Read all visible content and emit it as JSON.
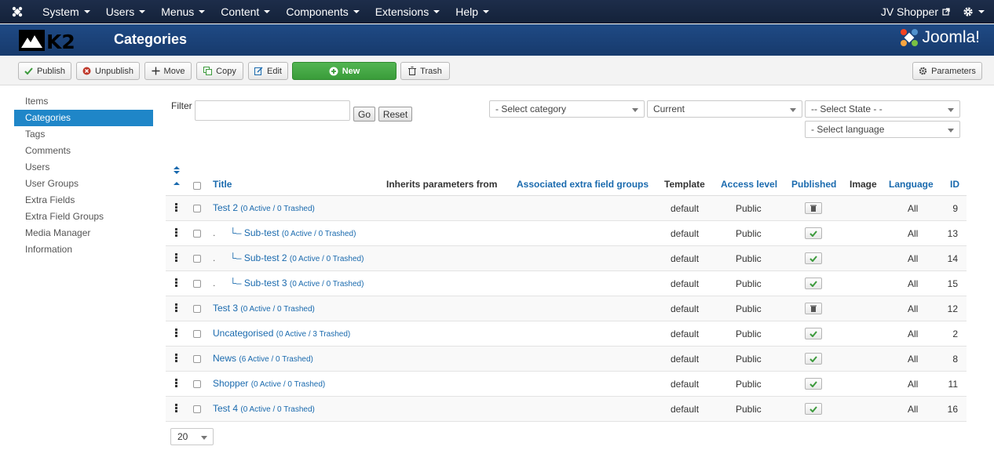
{
  "topbar": {
    "menu": [
      "System",
      "Users",
      "Menus",
      "Content",
      "Components",
      "Extensions",
      "Help"
    ],
    "user": "JV Shopper"
  },
  "header": {
    "title": "Categories",
    "brand": "Joomla!",
    "k2": "K2"
  },
  "toolbar": {
    "publish": "Publish",
    "unpublish": "Unpublish",
    "move": "Move",
    "copy": "Copy",
    "edit": "Edit",
    "new": "New",
    "trash": "Trash",
    "parameters": "Parameters"
  },
  "sidebar": {
    "items": [
      "Items",
      "Categories",
      "Tags",
      "Comments",
      "Users",
      "User Groups",
      "Extra Fields",
      "Extra Field Groups",
      "Media Manager",
      "Information"
    ]
  },
  "filters": {
    "label": "Filter",
    "go": "Go",
    "reset": "Reset",
    "category": "- Select category",
    "current": "Current",
    "state": "-- Select State - -",
    "language": "- Select language"
  },
  "table": {
    "headers": {
      "title": "Title",
      "inherits": "Inherits parameters from",
      "extra": "Associated extra field groups",
      "template": "Template",
      "access": "Access level",
      "published": "Published",
      "image": "Image",
      "language": "Language",
      "id": "ID"
    },
    "rows": [
      {
        "title": "Test 2",
        "counts": "(0 Active / 0 Trashed)",
        "template": "default",
        "access": "Public",
        "lang": "All",
        "id": "9",
        "published": false
      },
      {
        "title": "Sub-test",
        "counts": "(0 Active / 0 Trashed)",
        "template": "default",
        "access": "Public",
        "lang": "All",
        "id": "13",
        "published": true
      },
      {
        "title": "Sub-test 2",
        "counts": "(0 Active / 0 Trashed)",
        "template": "default",
        "access": "Public",
        "lang": "All",
        "id": "14",
        "published": true
      },
      {
        "title": "Sub-test 3",
        "counts": "(0 Active / 0 Trashed)",
        "template": "default",
        "access": "Public",
        "lang": "All",
        "id": "15",
        "published": true
      },
      {
        "title": "Test 3",
        "counts": "(0 Active / 0 Trashed)",
        "template": "default",
        "access": "Public",
        "lang": "All",
        "id": "12",
        "published": false
      },
      {
        "title": "Uncategorised",
        "counts": "(0 Active / 3 Trashed)",
        "template": "default",
        "access": "Public",
        "lang": "All",
        "id": "2",
        "published": true
      },
      {
        "title": "News",
        "counts": "(6 Active / 0 Trashed)",
        "template": "default",
        "access": "Public",
        "lang": "All",
        "id": "8",
        "published": true
      },
      {
        "title": "Shopper",
        "counts": "(0 Active / 0 Trashed)",
        "template": "default",
        "access": "Public",
        "lang": "All",
        "id": "11",
        "published": true
      },
      {
        "title": "Test 4",
        "counts": "(0 Active / 0 Trashed)",
        "template": "default",
        "access": "Public",
        "lang": "All",
        "id": "16",
        "published": true
      }
    ]
  },
  "pager": {
    "limit": "20"
  },
  "colors": {
    "accent": "#1f86c8",
    "new_button": "#46a846",
    "header": "#1f4a85",
    "topbar": "#1b2a45"
  }
}
